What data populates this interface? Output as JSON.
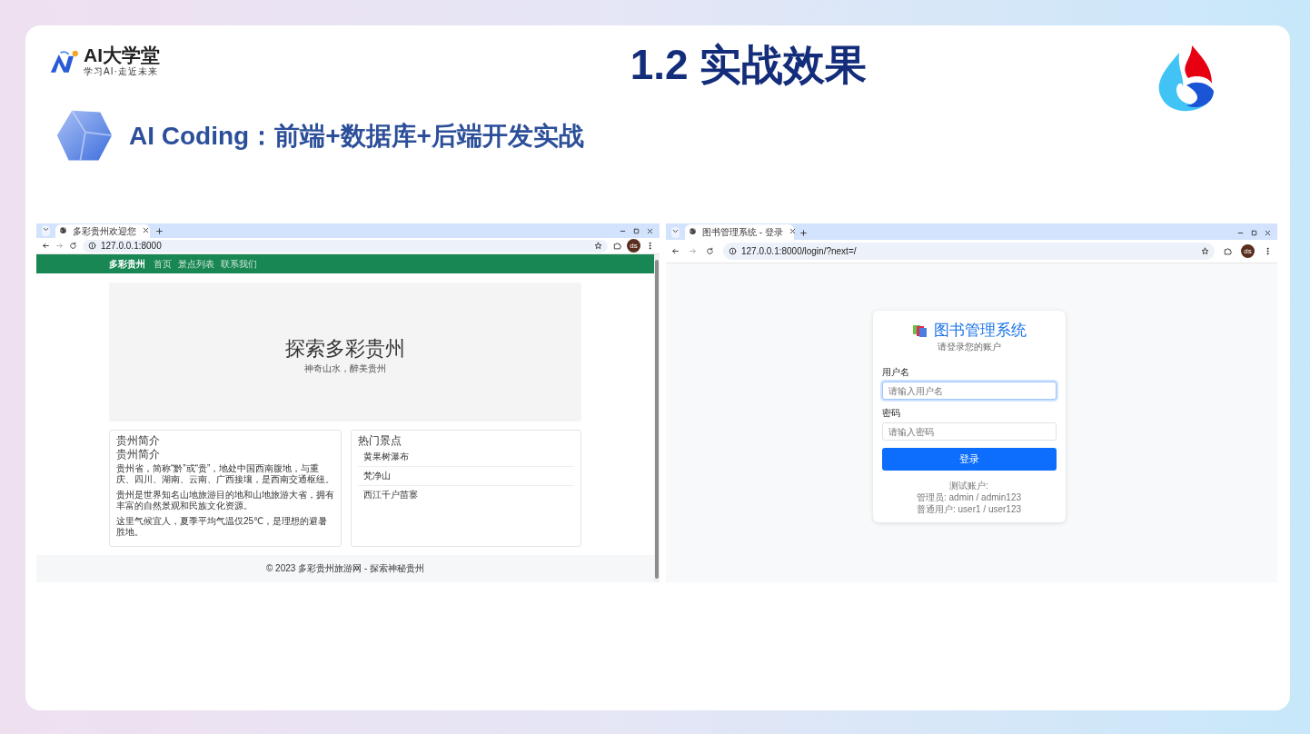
{
  "slide": {
    "logo_name": "AI大学堂",
    "logo_tagline": "学习AI·走近未来",
    "title": "1.2 实战效果",
    "subtitle": "AI Coding：前端+数据库+后端开发实战"
  },
  "browsers": [
    {
      "kind": "travel",
      "tab_title": "多彩贵州欢迎您",
      "url": "127.0.0.1:8000",
      "profile": "ds",
      "page": {
        "brand": "多彩贵州",
        "nav": [
          "首页",
          "景点列表",
          "联系我们"
        ],
        "hero": {
          "title": "探索多彩贵州",
          "subtitle": "神奇山水，醉美贵州"
        },
        "intro": {
          "card_title": "贵州简介",
          "heading": "贵州简介",
          "paragraphs": [
            "贵州省，简称“黔”或“贵”，地处中国西南腹地，与重庆、四川、湖南、云南、广西接壤，是西南交通枢纽。",
            "贵州是世界知名山地旅游目的地和山地旅游大省，拥有丰富的自然景观和民族文化资源。",
            "这里气候宜人，夏季平均气温仅25℃，是理想的避暑胜地。"
          ]
        },
        "attractions": {
          "title": "热门景点",
          "items": [
            "黄果树瀑布",
            "梵净山",
            "西江千户苗寨"
          ]
        },
        "footer": "© 2023 多彩贵州旅游网 - 探索神秘贵州"
      }
    },
    {
      "kind": "login",
      "tab_title": "图书管理系统 - 登录",
      "url": "127.0.0.1:8000/login/?next=/",
      "profile": "ds",
      "page": {
        "title": "图书管理系统",
        "subtitle": "请登录您的账户",
        "fields": [
          {
            "label": "用户名",
            "placeholder": "请输入用户名",
            "focused": true
          },
          {
            "label": "密码",
            "placeholder": "请输入密码",
            "focused": false
          }
        ],
        "button": "登录",
        "hint_title": "测试账户:",
        "hints": [
          "管理员: admin / admin123",
          "普通用户: user1 / user123"
        ]
      }
    }
  ]
}
